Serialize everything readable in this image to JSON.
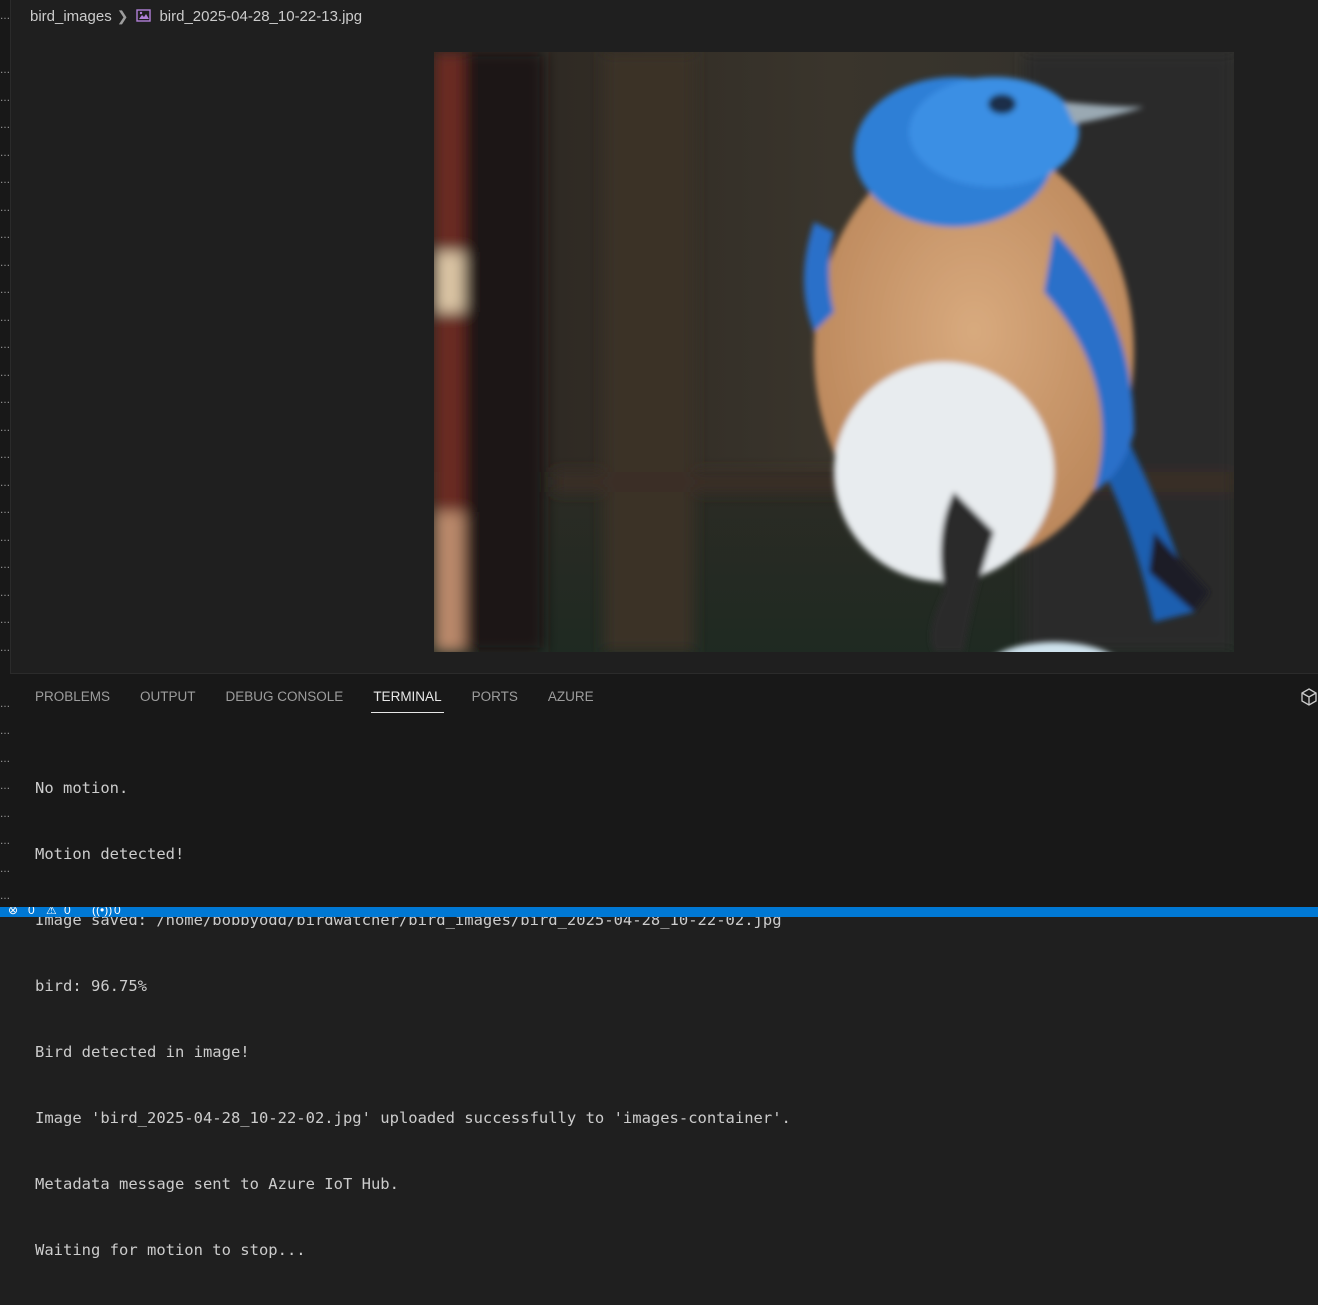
{
  "breadcrumb": {
    "folder": "bird_images",
    "file": "bird_2025-04-28_10-22-13.jpg"
  },
  "panel": {
    "tabs": [
      {
        "label": "PROBLEMS",
        "active": false
      },
      {
        "label": "OUTPUT",
        "active": false
      },
      {
        "label": "DEBUG CONSOLE",
        "active": false
      },
      {
        "label": "TERMINAL",
        "active": true
      },
      {
        "label": "PORTS",
        "active": false
      },
      {
        "label": "AZURE",
        "active": false
      }
    ]
  },
  "terminal": {
    "lines": [
      "No motion.",
      "Motion detected!",
      "Image saved: /home/bobbyodd/birdwatcher/bird_images/bird_2025-04-28_10-22-02.jpg",
      "bird: 96.75%",
      "Bird detected in image!",
      "Image 'bird_2025-04-28_10-22-02.jpg' uploaded successfully to 'images-container'.",
      "Metadata message sent to Azure IoT Hub.",
      "Waiting for motion to stop..."
    ]
  },
  "status_bar": {
    "errors": "0",
    "warnings": "0",
    "ports": "0"
  },
  "colors": {
    "status_bar": "#0078d4",
    "editor_bg": "#1f1f1f",
    "panel_bg": "#181818"
  }
}
